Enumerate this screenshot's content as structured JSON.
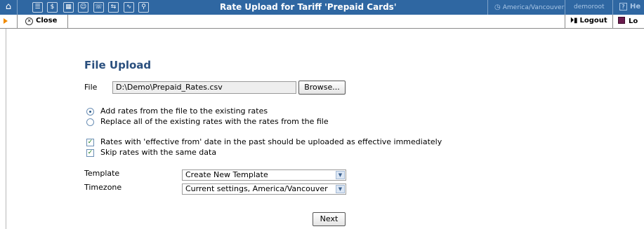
{
  "window": {
    "title": "Rate Upload for Tariff 'Prepaid Cards'",
    "timezone": "America/Vancouver",
    "user": "demoroot",
    "help_label": "He"
  },
  "topbar_icons": [
    "home-icon",
    "list-icon",
    "dollar-icon",
    "grid-icon",
    "person-icon",
    "phone-icon",
    "transfer-icon",
    "chart-icon",
    "search-icon"
  ],
  "toolbar": {
    "close_label": "Close",
    "logout_label": "Logout",
    "lo_label": "Lo"
  },
  "form": {
    "heading": "File Upload",
    "file_label": "File",
    "file_value": "D:\\Demo\\Prepaid_Rates.csv",
    "browse_label": "Browse...",
    "mode_options": [
      {
        "label": "Add rates from the file to the existing rates",
        "selected": true
      },
      {
        "label": "Replace all of the existing rates with the rates from the file",
        "selected": false
      }
    ],
    "checkboxes": [
      {
        "label": "Rates with 'effective from' date in the past should be uploaded as effective immediately",
        "checked": true
      },
      {
        "label": "Skip rates with the same data",
        "checked": true
      }
    ],
    "template_label": "Template",
    "template_value": "Create New Template",
    "timezone_label": "Timezone",
    "timezone_value": "Current settings, America/Vancouver",
    "next_label": "Next"
  },
  "colors": {
    "titlebar": "#2f67a2",
    "heading": "#2a4f7e",
    "accent_arrow": "#f08a00"
  }
}
